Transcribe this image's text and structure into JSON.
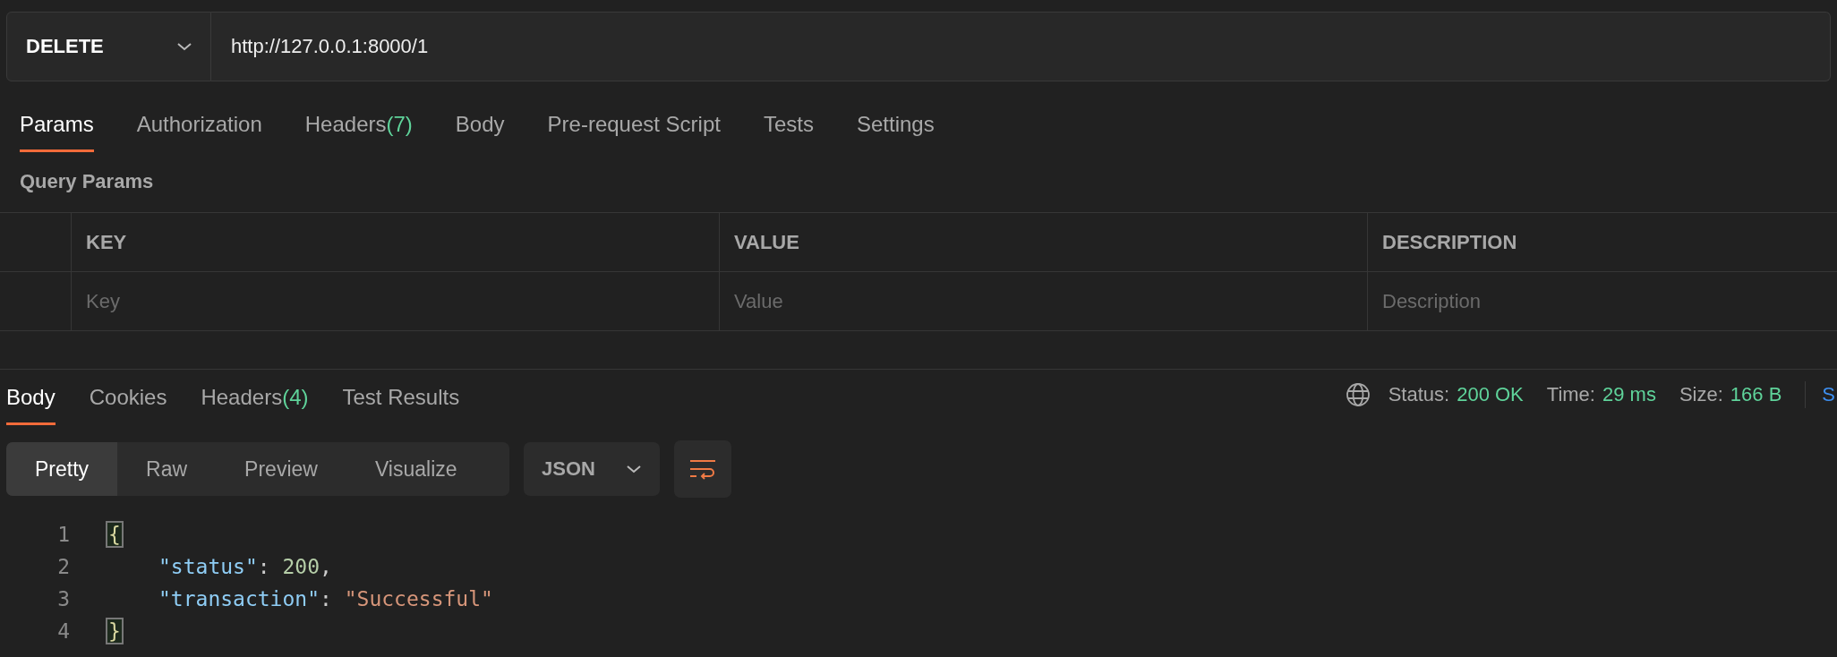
{
  "request": {
    "method": "DELETE",
    "url": "http://127.0.0.1:8000/1"
  },
  "request_tabs": [
    {
      "label": "Params",
      "selected": true
    },
    {
      "label": "Authorization",
      "selected": false
    },
    {
      "label": "Headers",
      "count": "(7)",
      "selected": false
    },
    {
      "label": "Body",
      "selected": false
    },
    {
      "label": "Pre-request Script",
      "selected": false
    },
    {
      "label": "Tests",
      "selected": false
    },
    {
      "label": "Settings",
      "selected": false
    }
  ],
  "query_params": {
    "title": "Query Params",
    "columns": [
      "KEY",
      "VALUE",
      "DESCRIPTION"
    ],
    "placeholders": [
      "Key",
      "Value",
      "Description"
    ]
  },
  "response_tabs": [
    {
      "label": "Body",
      "selected": true
    },
    {
      "label": "Cookies",
      "selected": false
    },
    {
      "label": "Headers",
      "count": "(4)",
      "selected": false
    },
    {
      "label": "Test Results",
      "selected": false
    }
  ],
  "response_stats": [
    {
      "label": "Status:",
      "value": "200 OK"
    },
    {
      "label": "Time:",
      "value": "29 ms"
    },
    {
      "label": "Size:",
      "value": "166 B"
    }
  ],
  "cut_off_action": "S",
  "view_modes": [
    {
      "label": "Pretty",
      "selected": true
    },
    {
      "label": "Raw",
      "selected": false
    },
    {
      "label": "Preview",
      "selected": false
    },
    {
      "label": "Visualize",
      "selected": false
    }
  ],
  "format": "JSON",
  "code": [
    {
      "number": "1",
      "tokens": [
        {
          "kind": "bracket",
          "text": "{"
        }
      ]
    },
    {
      "number": "2",
      "tokens": [
        {
          "kind": "key",
          "text": "\"status\""
        },
        {
          "kind": "punct",
          "text": ": "
        },
        {
          "kind": "number",
          "text": "200"
        },
        {
          "kind": "punct",
          "text": ","
        }
      ]
    },
    {
      "number": "3",
      "tokens": [
        {
          "kind": "key",
          "text": "\"transaction\""
        },
        {
          "kind": "punct",
          "text": ": "
        },
        {
          "kind": "string",
          "text": "\"Successful\""
        }
      ]
    },
    {
      "number": "4",
      "tokens": [
        {
          "kind": "bracket",
          "text": "}"
        }
      ]
    }
  ]
}
